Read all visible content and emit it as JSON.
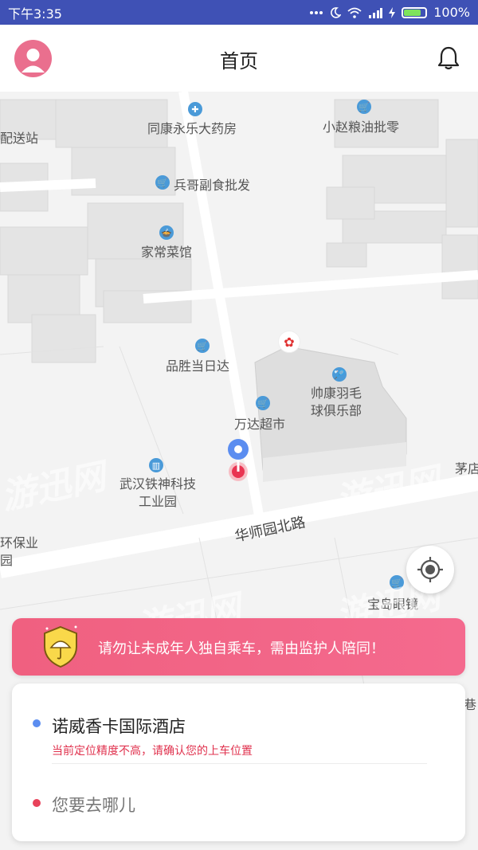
{
  "status_bar": {
    "time": "下午3:35",
    "signal_icons": [
      "dots-icon",
      "moon-icon",
      "wifi-icon",
      "cellular-icon",
      "charging-icon",
      "battery-icon"
    ],
    "battery": "100%"
  },
  "header": {
    "title": "首页",
    "avatar_color": "#ea6f8e",
    "bell_icon": "bell-icon"
  },
  "map": {
    "pois": [
      {
        "name": "同康永乐大药房",
        "icon": "pharmacy-icon"
      },
      {
        "name": "小赵粮油批零",
        "icon": "shop-icon"
      },
      {
        "name": "兵哥副食批发",
        "icon": "shop-icon"
      },
      {
        "name": "家常菜馆",
        "icon": "restaurant-icon"
      },
      {
        "name": "品胜当日达",
        "icon": "shop-icon"
      },
      {
        "name": "帅康羽毛球俱乐部",
        "icon": "badminton-icon"
      },
      {
        "name": "万达超市",
        "icon": "shop-icon"
      },
      {
        "name": "武汉铁神科技工业园",
        "icon": "building-icon"
      },
      {
        "name": "宝岛眼镜",
        "icon": "shop-icon"
      },
      {
        "name": "配送站",
        "icon": ""
      },
      {
        "name": "茅店",
        "icon": ""
      },
      {
        "name": "环保业园",
        "icon": ""
      },
      {
        "name": "巷",
        "icon": ""
      }
    ],
    "road": "华师园北路",
    "watermark": "游迅网"
  },
  "notice": {
    "text": "请勿让未成年人独自乘车，需由监护人陪同！",
    "icon": "umbrella-shield-icon",
    "gradient": [
      "#f06080",
      "#f46a8e"
    ]
  },
  "trip": {
    "start_name": "诺威香卡国际酒店",
    "accuracy_warning": "当前定位精度不高，请确认您的上车位置",
    "destination_placeholder": "您要去哪儿",
    "start_dot_color": "#5b8df0",
    "dest_dot_color": "#e8425a"
  }
}
